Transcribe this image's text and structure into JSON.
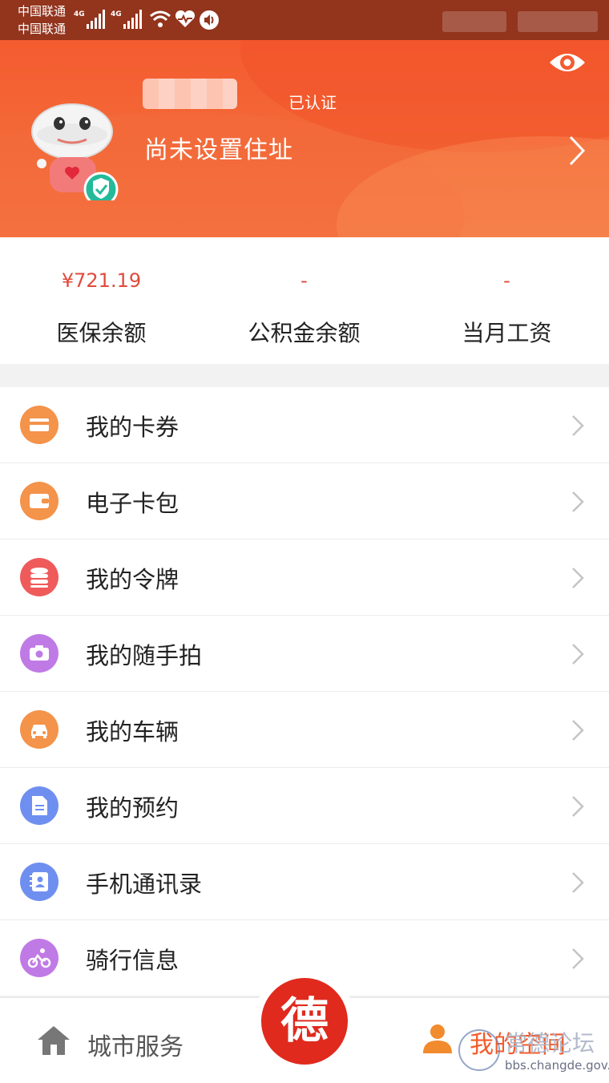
{
  "status_bar": {
    "carrier_1": "中国联通",
    "carrier_2": "中国联通",
    "network_1": "4G",
    "network_2": "4G"
  },
  "header": {
    "verified_label": "已认证",
    "address": "尚未设置住址"
  },
  "balances": [
    {
      "value": "¥721.19",
      "label": "医保余额"
    },
    {
      "value": "-",
      "label": "公积金余额"
    },
    {
      "value": "-",
      "label": "当月工资"
    }
  ],
  "menu": [
    {
      "label": "我的卡券",
      "icon": "card-icon",
      "color": "#f4934a"
    },
    {
      "label": "电子卡包",
      "icon": "wallet-icon",
      "color": "#f4934a"
    },
    {
      "label": "我的令牌",
      "icon": "token-stack-icon",
      "color": "#ef5a5a"
    },
    {
      "label": "我的随手拍",
      "icon": "camera-icon",
      "color": "#c07ae6"
    },
    {
      "label": "我的车辆",
      "icon": "car-icon",
      "color": "#f4934a"
    },
    {
      "label": "我的预约",
      "icon": "document-icon",
      "color": "#6f8ff0"
    },
    {
      "label": "手机通讯录",
      "icon": "contacts-icon",
      "color": "#6f8ff0"
    },
    {
      "label": "骑行信息",
      "icon": "bicycle-icon",
      "color": "#c07ae6"
    }
  ],
  "tabbar": {
    "left_label": "城市服务",
    "center_label": "德",
    "right_label": "我的空间"
  },
  "watermark": {
    "title": "常德论坛",
    "url": "bbs.changde.gov.cn"
  },
  "colors": {
    "header": "#f45b30",
    "status_bar": "#93341d",
    "accent_red": "#e02a1d",
    "balance_red": "#e04a3c",
    "active_tab": "#f25b2a"
  }
}
